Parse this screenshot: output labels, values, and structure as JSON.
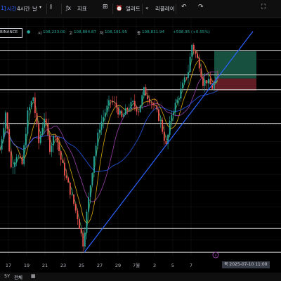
{
  "toolbar": {
    "interval_partial": "1",
    "interval_1h": "1시간",
    "interval_4h": "4시간",
    "interval_day": "날",
    "indicators": "지표",
    "alert": "얼러트",
    "replay": "리플레이"
  },
  "legend": {
    "symbol": "BINANCE",
    "open_label": "시",
    "open": "108,233.00",
    "high_label": "고",
    "high": "108,884.87",
    "low_label": "저",
    "low": "108,191.95",
    "close_label": "종",
    "close": "108,831.94",
    "change": "+598.95 (+0.55%)"
  },
  "footer": {
    "range_5y": "5Y",
    "range_all": "전체"
  },
  "time_tag": "목 2025-07-10   11:00",
  "colors": {
    "up": "#26a69a",
    "down": "#ef5350",
    "trendline": "#2962ff",
    "long_profit_zone": "#1b5e4a",
    "long_stop_zone": "#6b1f28",
    "grid": "#1a1a1a"
  },
  "chart_data": {
    "type": "candlestick",
    "x_tick_labels": [
      "17",
      "19",
      "21",
      "23",
      "25",
      "27",
      "29",
      "7월",
      "3",
      "5",
      "7"
    ],
    "y_range": [
      98000,
      112500
    ],
    "horizontal_levels": [
      110550,
      109050,
      108150,
      106100,
      99700,
      98250
    ],
    "trendline": {
      "from": [
        "2025-06-22",
        98250
      ],
      "to": [
        "2025-07-10",
        111700
      ]
    },
    "long_position": {
      "entry": 108831.94,
      "target": 110500,
      "stop": 108100
    },
    "moving_averages": [
      {
        "color": "#f0b90b",
        "period": 50
      },
      {
        "color": "#ab47bc",
        "period": 100
      },
      {
        "color": "#2962ff",
        "period": 200
      },
      {
        "color": "#4caf50",
        "period": 20
      }
    ],
    "price_waypoints": [
      [
        0,
        104500
      ],
      [
        3,
        106800
      ],
      [
        6,
        103400
      ],
      [
        9,
        104200
      ],
      [
        12,
        103600
      ],
      [
        15,
        106700
      ],
      [
        18,
        107700
      ],
      [
        21,
        104900
      ],
      [
        24,
        106500
      ],
      [
        27,
        104600
      ],
      [
        30,
        105500
      ],
      [
        33,
        103900
      ],
      [
        36,
        102700
      ],
      [
        39,
        101600
      ],
      [
        42,
        100400
      ],
      [
        45,
        98800
      ],
      [
        48,
        101500
      ],
      [
        51,
        104200
      ],
      [
        54,
        105900
      ],
      [
        57,
        106800
      ],
      [
        60,
        107500
      ],
      [
        63,
        107100
      ],
      [
        66,
        106400
      ],
      [
        69,
        107000
      ],
      [
        72,
        107300
      ],
      [
        75,
        106900
      ],
      [
        78,
        108100
      ],
      [
        81,
        107600
      ],
      [
        84,
        107000
      ],
      [
        87,
        106200
      ],
      [
        90,
        104700
      ],
      [
        93,
        106700
      ],
      [
        96,
        107500
      ],
      [
        99,
        108400
      ],
      [
        102,
        109300
      ],
      [
        104,
        110900
      ],
      [
        106,
        110300
      ],
      [
        108,
        109700
      ],
      [
        110,
        108600
      ],
      [
        112,
        108700
      ],
      [
        115,
        108300
      ],
      [
        118,
        108900
      ]
    ]
  }
}
